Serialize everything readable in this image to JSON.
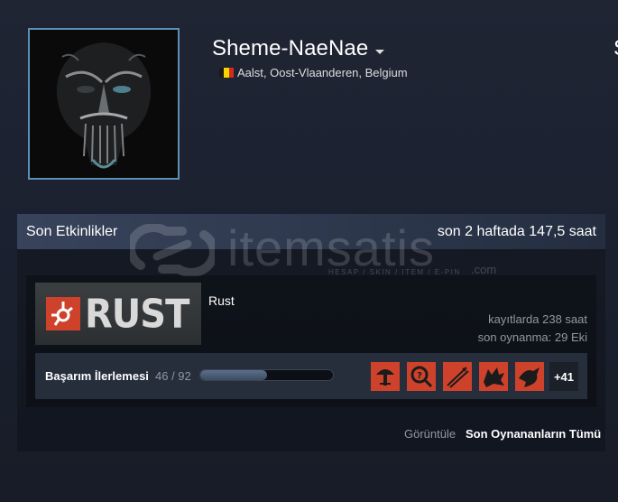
{
  "profile": {
    "persona_name": "Sheme-NaeNae",
    "location": "Aalst, Oost-Vlaanderen, Belgium",
    "flag_colors": [
      "#1a1a1a",
      "#f5d400",
      "#d52b1e"
    ],
    "avatar_accent": "#5e8eb4",
    "edge_letter": "S"
  },
  "activity": {
    "title": "Son Etkinlikler",
    "hours_summary": "son 2 haftada 147,5 saat"
  },
  "watermark": {
    "text": "itemsatis",
    "subtext": "HESAP / SKIN / ITEM / E-PIN",
    "suffix": ".com"
  },
  "game": {
    "logo_text": "RUST",
    "name": "Rust",
    "playtime": "kayıtlarda 238 saat",
    "last_played": "son oynanma: 29 Eki",
    "brand_color": "#ce422b"
  },
  "achievements": {
    "label": "Başarım İlerlemesi",
    "count_text": "46 / 92",
    "progress_fraction": 0.5,
    "icons": [
      "mushroom-icon",
      "question-search-icon",
      "arrows-icon",
      "wolf-icon",
      "bird-icon"
    ],
    "more_text": "+41"
  },
  "footer": {
    "view_label": "Görüntüle",
    "view_link": "Son Oynananların Tümü"
  }
}
